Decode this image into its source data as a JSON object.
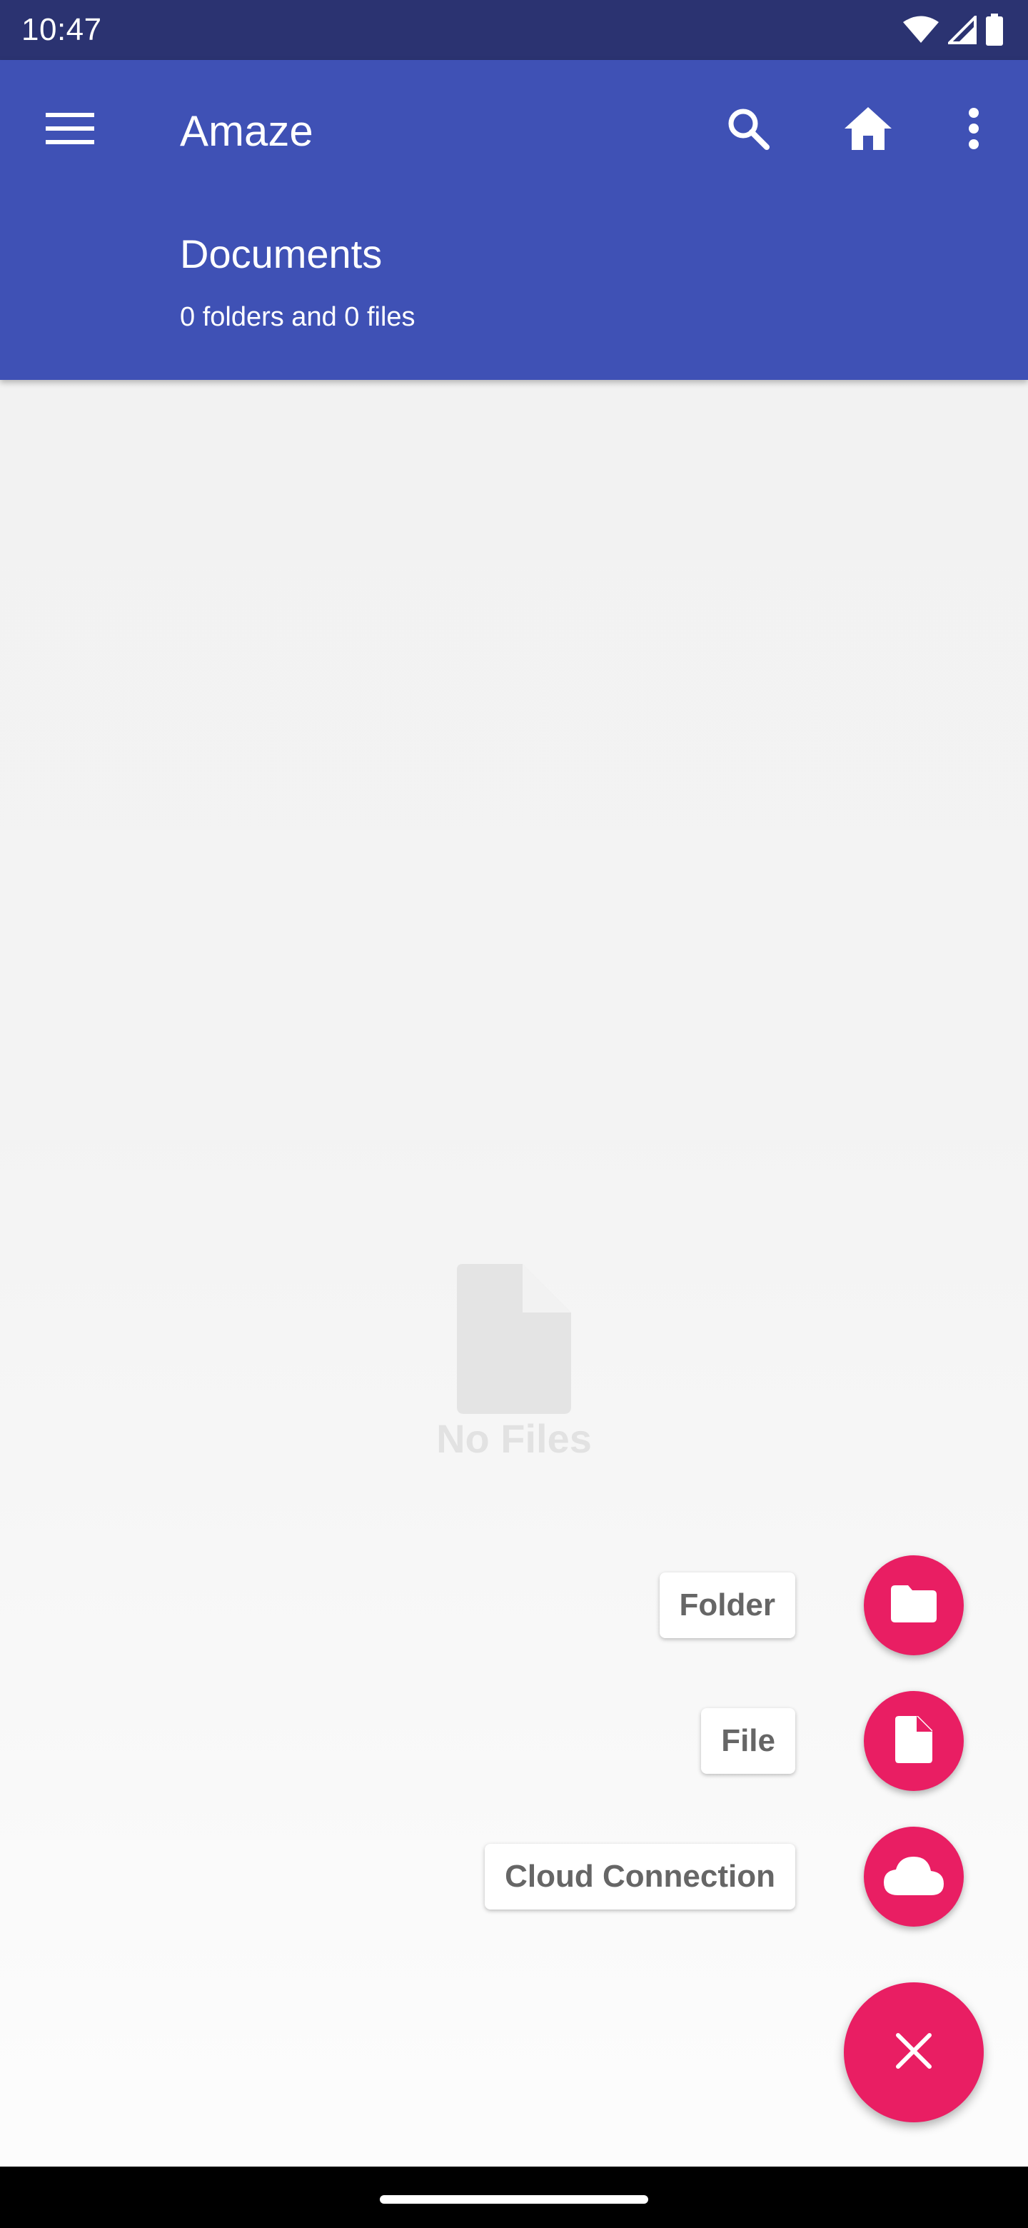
{
  "status_bar": {
    "time": "10:47",
    "icons": [
      "wifi-icon",
      "cellular-signal-icon",
      "battery-icon"
    ]
  },
  "app_bar": {
    "title": "Amaze",
    "background_color": "#3f51b5",
    "status_bar_color": "#2b3371",
    "actions": [
      "menu-icon",
      "search-icon",
      "home-icon",
      "more-vert-icon"
    ],
    "folder_name": "Documents",
    "folder_summary": "0 folders and 0 files"
  },
  "empty_state": {
    "icon": "file-icon",
    "text": "No Files"
  },
  "speed_dial": {
    "accent_color": "#e91e63",
    "items": [
      {
        "label": "Folder",
        "icon": "folder-icon"
      },
      {
        "label": "File",
        "icon": "file-icon"
      },
      {
        "label": "Cloud Connection",
        "icon": "cloud-icon"
      }
    ],
    "main_icon": "close-icon"
  }
}
